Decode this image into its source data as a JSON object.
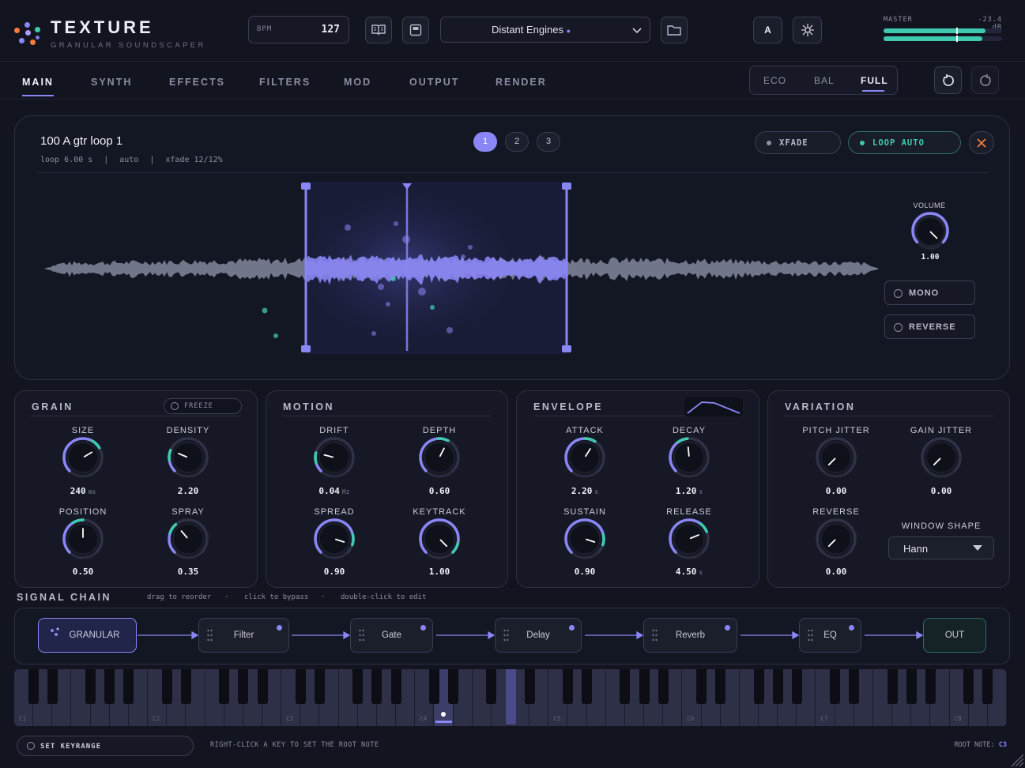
{
  "app": {
    "title": "TEXTURE",
    "subtitle": "GRANULAR SOUNDSCAPER"
  },
  "header": {
    "bpm_label": "BPM",
    "bpm_value": "127",
    "preset_name": "Distant Engines",
    "ab_label": "A",
    "master_label": "MASTER",
    "master_db": "-23.4 dB",
    "meter_levels": [
      0.86,
      0.83
    ]
  },
  "nav": {
    "tabs": [
      "MAIN",
      "SYNTH",
      "EFFECTS",
      "FILTERS",
      "MOD",
      "OUTPUT",
      "RENDER"
    ],
    "active_tab": "MAIN",
    "quality": [
      "ECO",
      "BAL",
      "FULL"
    ],
    "active_quality": "FULL"
  },
  "sample": {
    "name": "100 A gtr loop 1",
    "info_loop": "loop 6.00 s",
    "info_mode": "auto",
    "info_xfade": "xfade 12/12%",
    "slots": [
      "1",
      "2",
      "3"
    ],
    "active_slot": "1",
    "xfade_label": "XFADE",
    "loop_label": "LOOP AUTO",
    "volume_label": "VOLUME",
    "volume_value": "1.00",
    "mono_label": "MONO",
    "reverse_label": "REVERSE"
  },
  "modules": {
    "grain": {
      "title": "GRAIN",
      "freeze_label": "FREEZE",
      "knobs": [
        {
          "label": "SIZE",
          "value": "240",
          "unit": "ms",
          "level": 0.72
        },
        {
          "label": "DENSITY",
          "value": "2.20",
          "unit": "",
          "level": 0.25
        },
        {
          "label": "POSITION",
          "value": "0.50",
          "unit": "",
          "level": 0.5
        },
        {
          "label": "SPRAY",
          "value": "0.35",
          "unit": "",
          "level": 0.35
        }
      ]
    },
    "motion": {
      "title": "MOTION",
      "knobs": [
        {
          "label": "DRIFT",
          "value": "0.04",
          "unit": "Hz",
          "level": 0.22
        },
        {
          "label": "DEPTH",
          "value": "0.60",
          "unit": "",
          "level": 0.6
        },
        {
          "label": "SPREAD",
          "value": "0.90",
          "unit": "",
          "level": 0.9
        },
        {
          "label": "KEYTRACK",
          "value": "1.00",
          "unit": "",
          "level": 1.0
        }
      ]
    },
    "envelope": {
      "title": "ENVELOPE",
      "knobs": [
        {
          "label": "ATTACK",
          "value": "2.20",
          "unit": "s",
          "level": 0.62
        },
        {
          "label": "DECAY",
          "value": "1.20",
          "unit": "s",
          "level": 0.48
        },
        {
          "label": "SUSTAIN",
          "value": "0.90",
          "unit": "",
          "level": 0.9
        },
        {
          "label": "RELEASE",
          "value": "4.50",
          "unit": "s",
          "level": 0.75
        }
      ]
    },
    "variation": {
      "title": "VARIATION",
      "knobs": [
        {
          "label": "PITCH JITTER",
          "value": "0.00",
          "unit": "",
          "level": 0.0
        },
        {
          "label": "GAIN JITTER",
          "value": "0.00",
          "unit": "",
          "level": 0.0
        },
        {
          "label": "REVERSE",
          "value": "0.00",
          "unit": "",
          "level": 0.0
        }
      ],
      "window_label": "WINDOW SHAPE",
      "window_value": "Hann"
    }
  },
  "signal_chain": {
    "title": "SIGNAL CHAIN",
    "hints": [
      "drag to reorder",
      "click to bypass",
      "double-click to edit"
    ],
    "nodes": [
      "GRANULAR",
      "Filter",
      "Gate",
      "Delay",
      "Reverb",
      "EQ",
      "OUT"
    ]
  },
  "keyboard": {
    "octave_labels": [
      "C1",
      "C2",
      "C3",
      "C4",
      "C5",
      "C6",
      "C7",
      "C8"
    ],
    "set_keyrange_label": "SET KEYRANGE",
    "hint": "RIGHT-CLICK A KEY TO SET THE ROOT NOTE",
    "root_note_label": "ROOT NOTE:",
    "root_note_value": "C3"
  },
  "colors": {
    "accent": "#8a86f5",
    "teal": "#3ec9b0",
    "bg": "#121420",
    "orange": "#ff7a3d"
  }
}
